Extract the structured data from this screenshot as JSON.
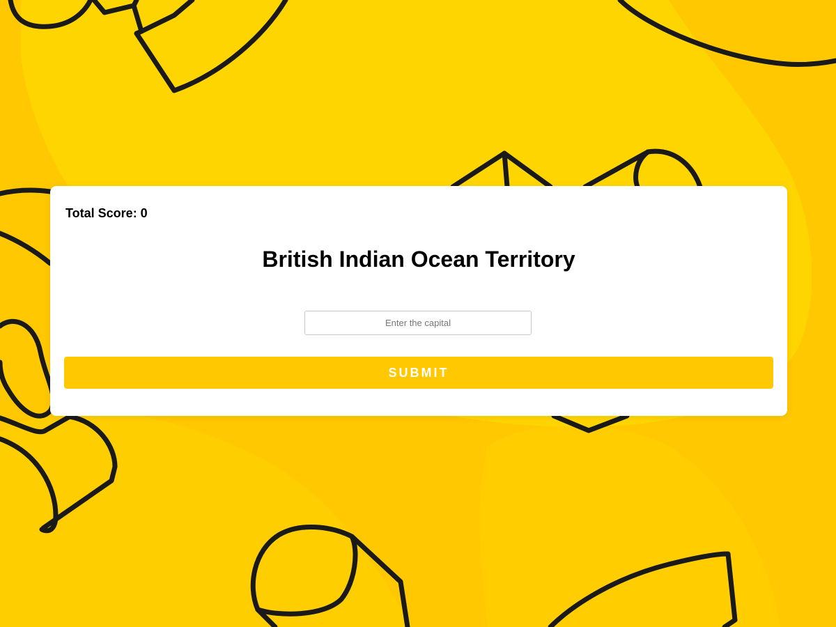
{
  "quiz": {
    "score_label": "Total Score: 0",
    "country": "British Indian Ocean Territory",
    "answer_value": "",
    "answer_placeholder": "Enter the capital",
    "submit_label": "SUBMIT"
  },
  "theme": {
    "background": "#FFC800",
    "blob": "#FFD500",
    "outline": "#1a1a1a",
    "card": "#FFFFFF",
    "button": "#FFC800"
  }
}
